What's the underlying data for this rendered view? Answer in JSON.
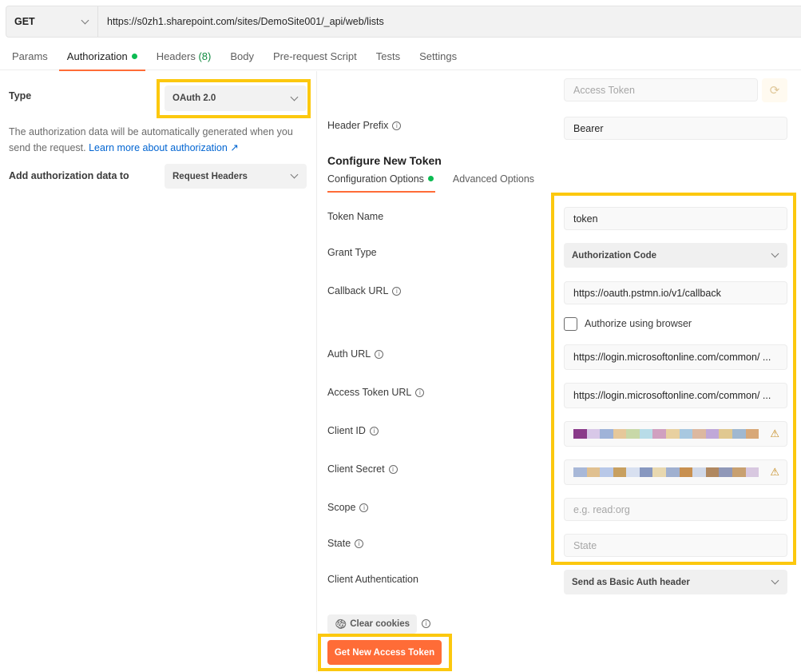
{
  "request": {
    "method": "GET",
    "url": "https://s0zh1.sharepoint.com/sites/DemoSite001/_api/web/lists"
  },
  "tabs": [
    {
      "label": "Params"
    },
    {
      "label": "Authorization",
      "active": true,
      "indicator": "green-dot"
    },
    {
      "label": "Headers",
      "count": "(8)"
    },
    {
      "label": "Body"
    },
    {
      "label": "Pre-request Script"
    },
    {
      "label": "Tests"
    },
    {
      "label": "Settings"
    }
  ],
  "left": {
    "type_label": "Type",
    "type_value": "OAuth 2.0",
    "description": "The authorization data will be automatically generated when you send the request.",
    "learn_more_link": "Learn more about authorization ↗",
    "add_to_label": "Add authorization data to",
    "add_to_value": "Request Headers"
  },
  "right": {
    "access_token_placeholder": "Access Token",
    "header_prefix_label": "Header Prefix",
    "header_prefix_value": "Bearer",
    "configure_heading": "Configure New Token",
    "subtabs": [
      {
        "label": "Configuration Options",
        "active": true
      },
      {
        "label": "Advanced Options"
      }
    ],
    "fields": {
      "token_name": {
        "label": "Token Name",
        "value": "token"
      },
      "grant_type": {
        "label": "Grant Type",
        "value": "Authorization Code"
      },
      "callback_url": {
        "label": "Callback URL",
        "value": "https://oauth.pstmn.io/v1/callback"
      },
      "authorize_browser": {
        "label": "Authorize using browser",
        "checked": false
      },
      "auth_url": {
        "label": "Auth URL",
        "value": "https://login.microsoftonline.com/common/ ..."
      },
      "access_token_url": {
        "label": "Access Token URL",
        "value": "https://login.microsoftonline.com/common/ ..."
      },
      "client_id": {
        "label": "Client ID",
        "value": "[redacted]"
      },
      "client_secret": {
        "label": "Client Secret",
        "value": "[redacted]"
      },
      "scope": {
        "label": "Scope",
        "placeholder": "e.g. read:org"
      },
      "state": {
        "label": "State",
        "placeholder": "State"
      },
      "client_auth": {
        "label": "Client Authentication",
        "value": "Send as Basic Auth header"
      }
    },
    "clear_cookies": "Clear cookies",
    "get_token": "Get New Access Token"
  },
  "colors": {
    "accent": "#ff6c37",
    "highlight": "#fcc80e",
    "indicator": "#0cbb52",
    "link": "#0265d2",
    "warning": "#c58b1f"
  }
}
